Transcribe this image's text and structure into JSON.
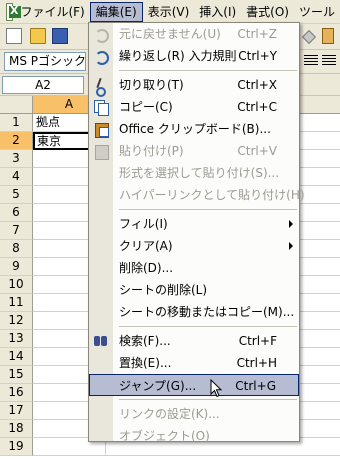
{
  "menubar": {
    "items": [
      "ファイル(F)",
      "編集(E)",
      "表示(V)",
      "挿入(I)",
      "書式(O)",
      "ツール"
    ]
  },
  "format": {
    "font_name": "MS Pゴシック"
  },
  "namebox": {
    "value": "A2"
  },
  "sheet": {
    "column_header": "A",
    "rows": [
      {
        "num": "1",
        "a": "拠点"
      },
      {
        "num": "2",
        "a": "東京"
      },
      {
        "num": "3",
        "a": ""
      },
      {
        "num": "4",
        "a": ""
      },
      {
        "num": "5",
        "a": ""
      },
      {
        "num": "6",
        "a": ""
      },
      {
        "num": "7",
        "a": ""
      },
      {
        "num": "8",
        "a": ""
      },
      {
        "num": "9",
        "a": ""
      },
      {
        "num": "10",
        "a": ""
      },
      {
        "num": "11",
        "a": ""
      },
      {
        "num": "12",
        "a": ""
      },
      {
        "num": "13",
        "a": ""
      },
      {
        "num": "14",
        "a": ""
      },
      {
        "num": "15",
        "a": ""
      },
      {
        "num": "16",
        "a": ""
      },
      {
        "num": "17",
        "a": ""
      },
      {
        "num": "18",
        "a": ""
      },
      {
        "num": "19",
        "a": ""
      }
    ]
  },
  "edit_menu": {
    "items": [
      {
        "label": "元に戻せません(U)",
        "shortcut": "Ctrl+Z",
        "disabled": true,
        "icon": "undo-icon"
      },
      {
        "label": "繰り返し(R) 入力規則",
        "shortcut": "Ctrl+Y",
        "disabled": false,
        "icon": "redo-icon"
      },
      {
        "label": "切り取り(T)",
        "shortcut": "Ctrl+X",
        "disabled": false,
        "icon": "cut-icon"
      },
      {
        "label": "コピー(C)",
        "shortcut": "Ctrl+C",
        "disabled": false,
        "icon": "copy-icon"
      },
      {
        "label": "Office クリップボード(B)...",
        "shortcut": "",
        "disabled": false,
        "icon": "clipboard-icon"
      },
      {
        "label": "貼り付け(P)",
        "shortcut": "Ctrl+V",
        "disabled": true,
        "icon": "paste-icon"
      },
      {
        "label": "形式を選択して貼り付け(S)...",
        "shortcut": "",
        "disabled": true,
        "icon": ""
      },
      {
        "label": "ハイパーリンクとして貼り付け(H)",
        "shortcut": "",
        "disabled": true,
        "icon": ""
      },
      {
        "label": "フィル(I)",
        "shortcut": "",
        "disabled": false,
        "submenu": true
      },
      {
        "label": "クリア(A)",
        "shortcut": "",
        "disabled": false,
        "submenu": true
      },
      {
        "label": "削除(D)...",
        "shortcut": "",
        "disabled": false
      },
      {
        "label": "シートの削除(L)",
        "shortcut": "",
        "disabled": false
      },
      {
        "label": "シートの移動またはコピー(M)...",
        "shortcut": "",
        "disabled": false
      },
      {
        "label": "検索(F)...",
        "shortcut": "Ctrl+F",
        "disabled": false,
        "icon": "find-icon"
      },
      {
        "label": "置換(E)...",
        "shortcut": "Ctrl+H",
        "disabled": false
      },
      {
        "label": "ジャンプ(G)...",
        "shortcut": "Ctrl+G",
        "disabled": false,
        "highlighted": true
      },
      {
        "label": "リンクの設定(K)...",
        "shortcut": "",
        "disabled": true
      },
      {
        "label": "オブジェクト(O)",
        "shortcut": "",
        "disabled": true
      }
    ]
  },
  "colors": {
    "menu_highlight": "#b6bdd2",
    "menu_highlight_border": "#0a246a",
    "header_active": "#f9c06a",
    "chrome": "#ece9d8"
  }
}
